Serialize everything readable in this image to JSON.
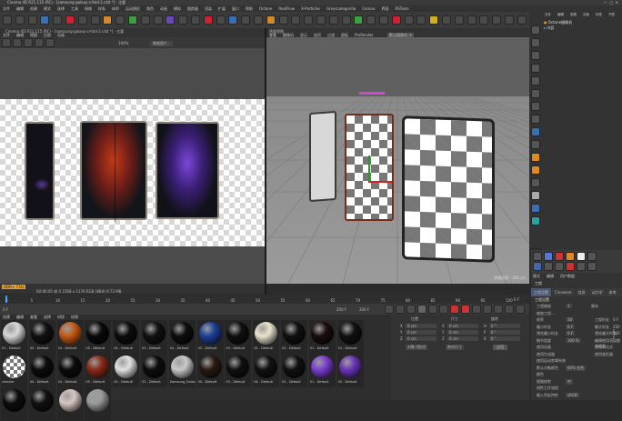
{
  "window": {
    "title": "Cinema 4D R21.115 (RC) - [samsung-galaxy-z-fold-2.c4d *] - 主要"
  },
  "menubar": [
    "文件",
    "编辑",
    "创建",
    "模式",
    "选择",
    "工具",
    "网格",
    "样条",
    "体积",
    "运动图形",
    "角色",
    "动画",
    "模拟",
    "跟踪器",
    "渲染",
    "扩展",
    "窗口",
    "帮助",
    "Octane",
    "RealFlow",
    "X-Particles",
    "Greyscalegorilla",
    "Corona",
    "界面",
    "RSTools"
  ],
  "picture_viewer": {
    "title": "Cinema 4D R21.115 (RC) - [samsung-galaxy-z-fold-2.c4d *] - 主要",
    "menu": [
      "文件",
      "编辑",
      "视图",
      "比较",
      "动画"
    ],
    "zoom": "100%",
    "tag": "HDR+ 7 Hz",
    "status": "00:00:05 帧 0 1568 x 1176 RGB (8Bit) 9.73 MB",
    "dropdown": "数据图片.."
  },
  "viewport": {
    "label": "透视视图",
    "menu": [
      "查看",
      "摄像机",
      "显示",
      "选项",
      "过滤",
      "面板",
      "ProRender"
    ],
    "camera": "默认摄像机 ·▾",
    "grid": "网格间距 : 100 cm"
  },
  "object_manager": {
    "menu": [
      "文件",
      "编辑",
      "查看",
      "对象",
      "标签",
      "书签"
    ],
    "items": [
      {
        "name": "Octane摄像机"
      },
      {
        "name": "内容"
      }
    ]
  },
  "attributes": {
    "menu": [
      "模式",
      "编辑",
      "用户数据"
    ],
    "title": "工程",
    "tabs": [
      "工程设置",
      "Cineware",
      "信息",
      "动力学",
      "参考",
      "待办事项",
      "帧插值",
      "场景节点"
    ],
    "section": "工程设置",
    "rows": [
      {
        "label": "工程缩放",
        "value": "1",
        "unit": "厘米"
      },
      {
        "label": "缩放工程..."
      },
      {
        "label": "帧率",
        "value": "30",
        "label2": "工程时长",
        "value2": "0 F"
      },
      {
        "label": "最小时长",
        "value": "0 F",
        "label2": "最大时长",
        "value2": "200 F"
      },
      {
        "label": "预览最小时长",
        "value": "0 F",
        "label2": "预览最大时长",
        "value2": "200 F"
      },
      {
        "label": "细节程度",
        "value": "100 %",
        "label2": "编辑使用渲染细节级别"
      },
      {
        "label": "使用动画",
        "label2": "使用表达式"
      },
      {
        "label": "使用生成器",
        "label2": "使用变形器"
      },
      {
        "label": "使用运动剪辑系统"
      },
      {
        "label": "默认对象颜色",
        "value": "60% 灰色"
      },
      {
        "label": "颜色"
      },
      {
        "label": "视图修剪",
        "value": "中"
      },
      {
        "label": "线性工作流程"
      },
      {
        "label": "输入色彩特性",
        "value": "sRGB"
      }
    ]
  },
  "timeline": {
    "ticks": [
      "0",
      "5",
      "10",
      "15",
      "20",
      "25",
      "30",
      "35",
      "40",
      "45",
      "50",
      "55",
      "60",
      "65",
      "70",
      "75",
      "80",
      "85",
      "90",
      "95",
      "100"
    ],
    "current": "0 F",
    "start": "0 F",
    "end": "200 F",
    "end2": "200 F",
    "max": "200 F"
  },
  "materials": {
    "menu": [
      "创建",
      "编辑",
      "查看",
      "选择",
      "材质",
      "纹理"
    ],
    "row1": [
      {
        "label": "01 - Default",
        "color": "#d8d8d8"
      },
      {
        "label": "05 - Default",
        "color": "#111111"
      },
      {
        "label": "04 - Default",
        "color": "#c45a16"
      },
      {
        "label": "05 - Default",
        "color": "#0a0a0a"
      },
      {
        "label": "04 - Default",
        "color": "#0c0c0c"
      },
      {
        "label": "03 - Default",
        "color": "#111111"
      },
      {
        "label": "04 - Default",
        "color": "#0d0d0d"
      },
      {
        "label": "02 - Default",
        "color": "#1d3f9a"
      },
      {
        "label": "03 - Default",
        "color": "#101010"
      },
      {
        "label": "02 - Default",
        "color": "#eae4cc"
      },
      {
        "label": "02 - Default",
        "color": "#101010"
      },
      {
        "label": "01 - Default",
        "color": "#1a0c0c"
      },
      {
        "label": "01 - Default",
        "color": "#111111"
      }
    ],
    "row2": [
      {
        "label": "checker",
        "color": "checker"
      },
      {
        "label": "04 - Default",
        "color": "#0c0c0c"
      },
      {
        "label": "04 - Default",
        "color": "#0c0c0c"
      },
      {
        "label": "05 - Default",
        "color": "#8a2b18"
      },
      {
        "label": "05 - Default",
        "color": "#e2e2e2"
      },
      {
        "label": "02 - Default",
        "color": "#0d0d0d"
      },
      {
        "label": "Samsung_Galaxy",
        "color": "#c9c9c9"
      },
      {
        "label": "00 - Default",
        "color": "#2a1a14"
      },
      {
        "label": "03 - Default",
        "color": "#101010"
      },
      {
        "label": "04 - Default",
        "color": "#111111"
      },
      {
        "label": "02 - Default",
        "color": "#111111"
      },
      {
        "label": "01 - Default",
        "color": "#7a3fd0"
      },
      {
        "label": "00 - Default",
        "color": "#6a35b8"
      }
    ],
    "row3": [
      {
        "label": "",
        "color": "#0d0d0d"
      },
      {
        "label": "",
        "color": "#111111"
      },
      {
        "label": "",
        "color": "#d8c7c2"
      },
      {
        "label": "",
        "color": "#9b9b9b"
      }
    ]
  },
  "coords": {
    "headers": [
      "位置",
      "尺寸",
      "旋转"
    ],
    "rows": [
      {
        "a": "X",
        "av": "0 cm",
        "b": "X",
        "bv": "0 cm",
        "c": "H",
        "cv": "0 °"
      },
      {
        "a": "Y",
        "av": "0 cm",
        "b": "Y",
        "bv": "0 cm",
        "c": "P",
        "cv": "0 °"
      },
      {
        "a": "Z",
        "av": "0 cm",
        "b": "Z",
        "bv": "0 cm",
        "c": "B",
        "cv": "0 °"
      }
    ],
    "mode": "对象 (相对)",
    "mode2": "绝对尺寸",
    "apply": "应用"
  }
}
